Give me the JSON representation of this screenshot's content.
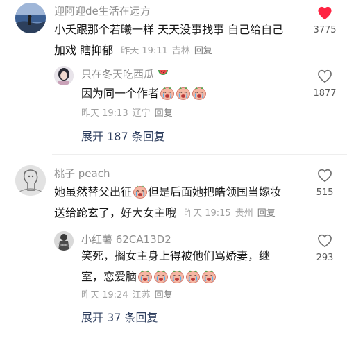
{
  "comments": [
    {
      "username": "迎阿迎de生活在远方",
      "text_line1": "小夭跟那个若曦一样 天天没事找事 自己给自己",
      "text_line2": "加戏 瞎抑郁",
      "time": "昨天 19:11",
      "location": "吉林",
      "reply": "回复",
      "likes": "3775",
      "liked": true,
      "avatar": "landscape-avatar",
      "replies": [
        {
          "username": "只在冬天吃西瓜",
          "text_prefix": "因为同一个作者",
          "emoji_count": 3,
          "time": "昨天 19:13",
          "location": "辽宁",
          "reply": "回复",
          "likes": "1877",
          "liked": false,
          "avatar": "portrait-avatar"
        }
      ],
      "expand_label": "展开 187 条回复"
    },
    {
      "username": "桃子 peach",
      "text_line1_a": "她虽然替父出征",
      "text_line1_b": "但是后面她把皓领国当嫁妆",
      "text_line2": "送给跄玄了，好大女主哦",
      "time": "昨天 19:15",
      "location": "贵州",
      "reply": "回复",
      "likes": "515",
      "liked": false,
      "avatar": "sketch-avatar",
      "replies": [
        {
          "username": "小红薯 62CA13D2",
          "text_line1": "笑死，搁女主身上得被他们骂娇妻，继",
          "text_line2_prefix": "室，恋爱脑",
          "emoji_count": 5,
          "time": "昨天 19:24",
          "location": "江苏",
          "reply": "回复",
          "likes": "293",
          "liked": false,
          "avatar": "tied-figure-avatar"
        }
      ],
      "expand_label": "展开 37 条回复"
    }
  ],
  "colors": {
    "heart_filled": "#ff2442",
    "heart_outline": "#707070",
    "expand_text": "#2f3f5f"
  }
}
